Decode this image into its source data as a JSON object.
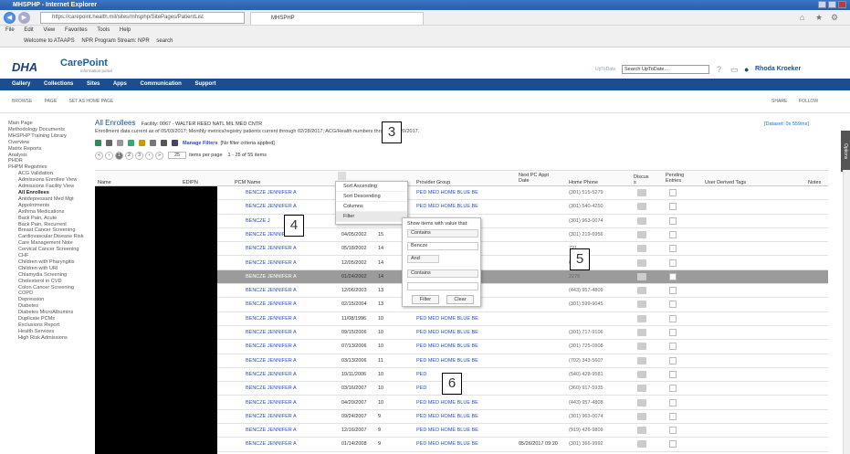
{
  "browser": {
    "title": "MHSPHP - Internet Explorer",
    "url": "https://carepoint.health.mil/sites/mhsphp/SitePages/PatientList",
    "tab_label": "MHSPHP",
    "menu": [
      "File",
      "Edit",
      "View",
      "Favorites",
      "Tools",
      "Help"
    ],
    "favorites": [
      "Welcome to ATAAPS",
      "NPR Program Stream: NPR",
      "search"
    ]
  },
  "site": {
    "logo_dha": "DHA",
    "logo_carepoint": "CarePoint",
    "logo_sub": "information portal",
    "uptodate_label": "UpToDate",
    "uptodate_placeholder": "Search UpToDate...",
    "user_name": "Rhoda Kroeker",
    "topnav": [
      "Gallery",
      "Collections",
      "Sites",
      "Apps",
      "Communication",
      "Support"
    ],
    "ribbon": [
      "BROWSE",
      "PAGE",
      "SET AS HOME PAGE"
    ],
    "share": "SHARE",
    "follow": "FOLLOW"
  },
  "leftnav": {
    "items": [
      "Main Page",
      "Methodology Documents",
      "MHSPHP Training Library",
      "Overview",
      "Matrix Reports",
      "Analysis",
      "PHDR",
      "PHPM Registries"
    ],
    "sub_items": [
      "ACG Validation",
      "Admissions Enrollee View",
      "Admissions Facility View",
      "All Enrollees",
      "Antidepressant Med Mgt",
      "Appointments",
      "Asthma Medications",
      "Back Pain, Acute",
      "Back Pain, Recurrent",
      "Breast Cancer Screening",
      "Cardiovascular Disease Risk",
      "Care Management Note",
      "Cervical Cancer Screening",
      "CHF",
      "Children with Pharyngitis",
      "Children with URI",
      "Chlamydia Screening",
      "Cholesterol in CVD",
      "Colon Cancer Screening",
      "COPD",
      "Depression",
      "Diabetes",
      "Diabetes MicroAlbumins",
      "Duplicate PCMs",
      "Exclusions Report",
      "Health Services",
      "High Risk Admissions"
    ]
  },
  "main": {
    "title": "All Enrollees",
    "facility": "Facility: 0067 - WALTER REED NATL MIL MED CNTR",
    "subtitle": "Enrollment data current as of 05/03/2017; Monthly metrics/registry patients current through 02/28/2017; ACG/Health                                numbers through 04/20/2017.",
    "manage_filters": "Manage Filters",
    "filter_status": "[No filter criteria applied]",
    "pages": [
      "1",
      "2",
      "3"
    ],
    "per_page": "25",
    "per_page_label": "items per page",
    "range": "1 - 25 of 55 items",
    "dataset": "[Dataset: 0s 559ms]",
    "options": "Options"
  },
  "table": {
    "headers": [
      "Name",
      "EDIPN",
      "PCM Name",
      "",
      "Provider Group",
      "Next PC Appt Date",
      "Home Phone",
      "Discus s",
      "Pending Entries",
      "User Derived Tags",
      "Notes"
    ],
    "rows": [
      {
        "pcm": "BENCZE JENNIFER A",
        "dob": "",
        "age": "",
        "prov": "PED MED HOME BLUE BE",
        "appt": "",
        "phone": "(301) 515-5279"
      },
      {
        "pcm": "BENCZE JENNIFER A",
        "dob": "",
        "age": "",
        "prov": "PED MED HOME BLUE BE",
        "appt": "",
        "phone": "(301) 540-4250"
      },
      {
        "pcm": "BENCZE J",
        "dob": "",
        "age": "",
        "prov": "",
        "appt": "",
        "phone": "(301) 963-0074"
      },
      {
        "pcm": "BENCZE JENNIFER A",
        "dob": "04/05/2002",
        "age": "15",
        "prov": "",
        "appt": "",
        "phone": "(301) 219-6956"
      },
      {
        "pcm": "BENCZE JENNIFER A",
        "dob": "05/18/2002",
        "age": "14",
        "prov": "",
        "appt": "",
        "phone": "721"
      },
      {
        "pcm": "BENCZE JENNIFER A",
        "dob": "12/05/2002",
        "age": "14",
        "prov": "",
        "appt": "",
        "phone": "666"
      },
      {
        "pcm": "BENCZE JENNIFER A",
        "dob": "01/24/2002",
        "age": "14",
        "prov": "",
        "appt": "",
        "phone": "2276"
      },
      {
        "pcm": "BENCZE JENNIFER A",
        "dob": "12/06/2003",
        "age": "13",
        "prov": "",
        "appt": "",
        "phone": "(443) 957-4809"
      },
      {
        "pcm": "BENCZE JENNIFER A",
        "dob": "02/15/2004",
        "age": "13",
        "prov": "",
        "appt": "",
        "phone": "(301) 599-9045"
      },
      {
        "pcm": "BENCZE JENNIFER A",
        "dob": "11/08/1996",
        "age": "10",
        "prov": "PED MED HOME BLUE BE",
        "appt": "",
        "phone": ""
      },
      {
        "pcm": "BENCZE JENNIFER A",
        "dob": "09/15/2006",
        "age": "10",
        "prov": "PED MED HOME BLUE BE",
        "appt": "",
        "phone": "(301) 717-9106"
      },
      {
        "pcm": "BENCZE JENNIFER A",
        "dob": "07/13/2006",
        "age": "10",
        "prov": "PED MED HOME BLUE BE",
        "appt": "",
        "phone": "(301) 725-0908"
      },
      {
        "pcm": "BENCZE JENNIFER A",
        "dob": "03/13/2006",
        "age": "11",
        "prov": "PED MED HOME BLUE BE",
        "appt": "",
        "phone": "(702) 343-5607"
      },
      {
        "pcm": "BENCZE JENNIFER A",
        "dob": "10/11/2006",
        "age": "10",
        "prov": "PED",
        "appt": "",
        "phone": "(540) 428-9581"
      },
      {
        "pcm": "BENCZE JENNIFER A",
        "dob": "03/16/2007",
        "age": "10",
        "prov": "PED",
        "appt": "",
        "phone": "(360) 917-5935"
      },
      {
        "pcm": "BENCZE JENNIFER A",
        "dob": "04/20/2007",
        "age": "10",
        "prov": "PED MED HOME BLUE BE",
        "appt": "",
        "phone": "(443) 957-4808"
      },
      {
        "pcm": "BENCZE JENNIFER A",
        "dob": "09/24/2007",
        "age": "9",
        "prov": "PED MED HOME BLUE BE",
        "appt": "",
        "phone": "(301) 963-0074"
      },
      {
        "pcm": "BENCZE JENNIFER A",
        "dob": "12/16/2007",
        "age": "9",
        "prov": "PED MED HOME BLUE BE",
        "appt": "",
        "phone": "(919) 426-9809"
      },
      {
        "pcm": "BENCZE JENNIFER A",
        "dob": "01/14/2008",
        "age": "9",
        "prov": "PED MED HOME BLUE BE",
        "appt": "05/26/2017 09:20",
        "phone": "(301) 366-9992"
      }
    ]
  },
  "colmenu": [
    "Sort Ascending",
    "Sort Descending",
    "Columns",
    "Filter"
  ],
  "filter": {
    "label": "Show items with value that:",
    "op1": "Contains",
    "val1": "Bencze",
    "logic": "And",
    "op2": "Contains",
    "filter_btn": "Filter",
    "clear_btn": "Clear"
  },
  "annotations": [
    "3",
    "4",
    "5",
    "6"
  ],
  "colors": {
    "accent": "#1b4d8f",
    "link": "#2a4fc8",
    "selected_row": "#9b9b9b"
  }
}
